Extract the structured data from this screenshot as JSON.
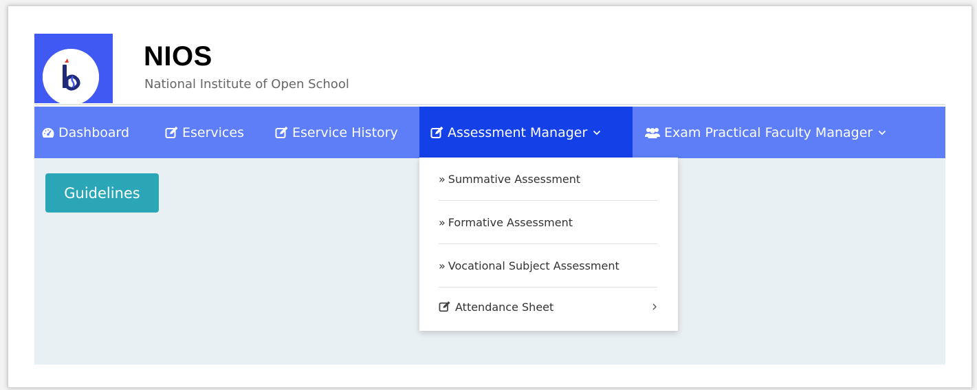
{
  "brand": {
    "title": "NIOS",
    "subtitle": "National Institute of Open School"
  },
  "nav": {
    "items": [
      {
        "label": "Dashboard",
        "icon": "tachometer-icon"
      },
      {
        "label": "Eservices",
        "icon": "edit-icon"
      },
      {
        "label": "Eservice History",
        "icon": "edit-icon"
      },
      {
        "label": "Assessment Manager",
        "icon": "edit-icon",
        "active": true,
        "has_dropdown": true
      },
      {
        "label": "Exam Practical Faculty Manager",
        "icon": "users-icon",
        "has_dropdown": true
      }
    ]
  },
  "content": {
    "guidelines_label": "Guidelines"
  },
  "dropdown": {
    "marker": "»",
    "items": [
      {
        "label": "Summative Assessment"
      },
      {
        "label": "Formative Assessment"
      },
      {
        "label": "Vocational Subject Assessment"
      },
      {
        "label": "Attendance Sheet",
        "icon": "edit-icon",
        "has_submenu": true
      }
    ]
  },
  "colors": {
    "navbar": "#5d7ef6",
    "nav_active": "#1440e8",
    "logo_bg": "#3f59f2",
    "content_bg": "#e9f0f3",
    "guidelines_button": "#2aa6b7"
  }
}
